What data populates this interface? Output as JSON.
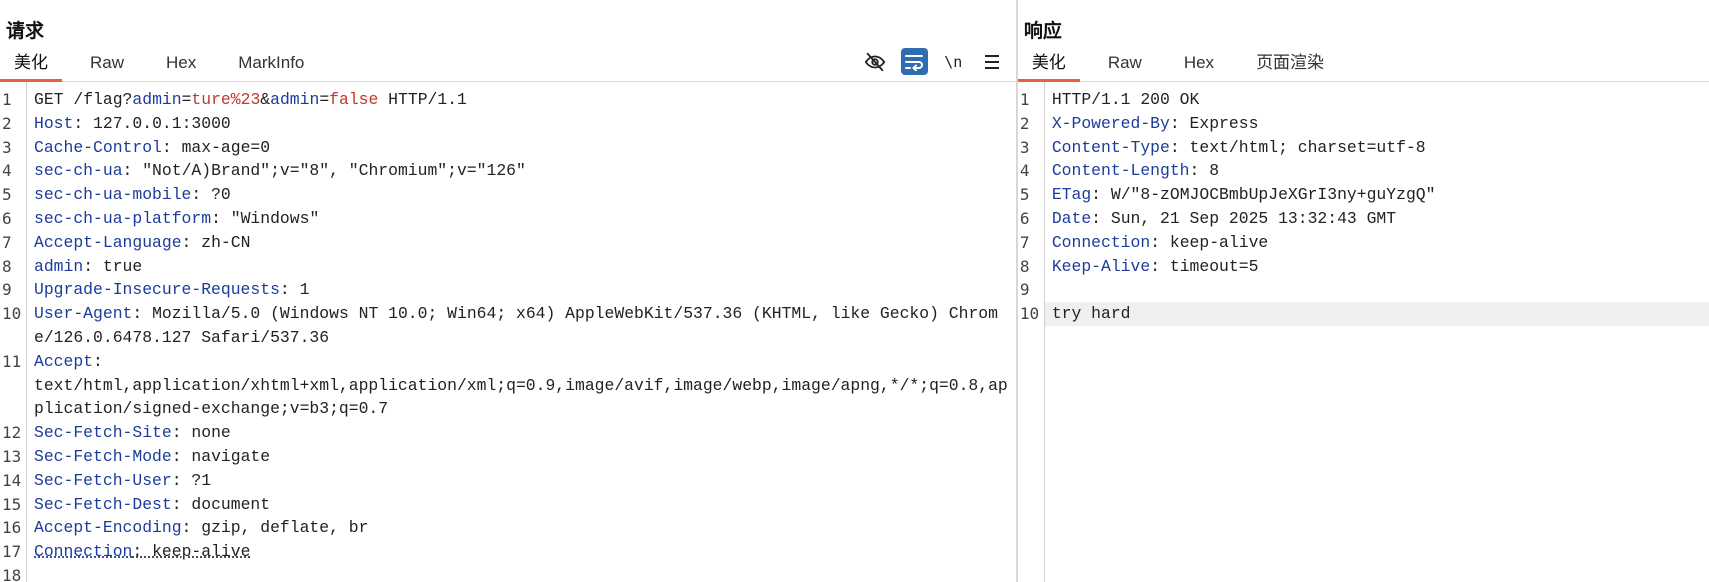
{
  "request": {
    "title": "请求",
    "tabs": [
      "美化",
      "Raw",
      "Hex",
      "MarkInfo"
    ],
    "active_tab": "美化",
    "toolbar": {
      "newline_label": "\\n"
    },
    "line_numbers": [
      "1",
      "2",
      "3",
      "4",
      "5",
      "6",
      "7",
      "8",
      "9",
      "10",
      "11",
      "12",
      "13",
      "14",
      "15",
      "16",
      "17",
      "18"
    ],
    "request_line": {
      "method": "GET ",
      "path": "/flag?",
      "p1_name": "admin",
      "eq1": "=",
      "p1_value": "ture%23",
      "amp": "&",
      "p2_name": "admin",
      "eq2": "=",
      "p2_value": "false",
      "protocol": " HTTP/1.1"
    },
    "headers": [
      {
        "name": "Host",
        "value": "127.0.0.1:3000"
      },
      {
        "name": "Cache-Control",
        "value": "max-age=0"
      },
      {
        "name": "sec-ch-ua",
        "value": "\"Not/A)Brand\";v=\"8\", \"Chromium\";v=\"126\""
      },
      {
        "name": "sec-ch-ua-mobile",
        "value": "?0"
      },
      {
        "name": "sec-ch-ua-platform",
        "value": "\"Windows\""
      },
      {
        "name": "Accept-Language",
        "value": "zh-CN"
      },
      {
        "name": "admin",
        "value": "true"
      },
      {
        "name": "Upgrade-Insecure-Requests",
        "value": "1"
      },
      {
        "name": "User-Agent",
        "value": "Mozilla/5.0 (Windows NT 10.0; Win64; x64) AppleWebKit/537.36 (KHTML, like Gecko) Chrome/126.0.6478.127 Safari/537.36"
      },
      {
        "name": "Accept",
        "value": "text/html,application/xhtml+xml,application/xml;q=0.9,image/avif,image/webp,image/apng,*/*;q=0.8,application/signed-exchange;v=b3;q=0.7"
      },
      {
        "name": "Sec-Fetch-Site",
        "value": "none"
      },
      {
        "name": "Sec-Fetch-Mode",
        "value": "navigate"
      },
      {
        "name": "Sec-Fetch-User",
        "value": "?1"
      },
      {
        "name": "Sec-Fetch-Dest",
        "value": "document"
      },
      {
        "name": "Accept-Encoding",
        "value": "gzip, deflate, br"
      },
      {
        "name": "Connection",
        "value": "keep-alive"
      }
    ]
  },
  "response": {
    "title": "响应",
    "tabs": [
      "美化",
      "Raw",
      "Hex",
      "页面渲染"
    ],
    "active_tab": "美化",
    "line_numbers": [
      "1",
      "2",
      "3",
      "4",
      "5",
      "6",
      "7",
      "8",
      "9",
      "10"
    ],
    "status_line": "HTTP/1.1 200 OK",
    "headers": [
      {
        "name": "X-Powered-By",
        "value": "Express"
      },
      {
        "name": "Content-Type",
        "value": "text/html; charset=utf-8"
      },
      {
        "name": "Content-Length",
        "value": "8"
      },
      {
        "name": "ETag",
        "value": "W/\"8-zOMJOCBmbUpJeXGrI3ny+guYzgQ\""
      },
      {
        "name": "Date",
        "value": "Sun, 21 Sep 2025 13:32:43 GMT"
      },
      {
        "name": "Connection",
        "value": "keep-alive"
      },
      {
        "name": "Keep-Alive",
        "value": "timeout=5"
      }
    ],
    "body": "try hard"
  },
  "colors": {
    "header_name": "#1c3c9c",
    "param_value": "#c0392b",
    "active_tab_underline": "#e8603c",
    "toggle_on": "#2e6db0"
  },
  "icons": [
    "eye-off-icon",
    "word-wrap-icon",
    "newline-icon",
    "menu-icon"
  ]
}
